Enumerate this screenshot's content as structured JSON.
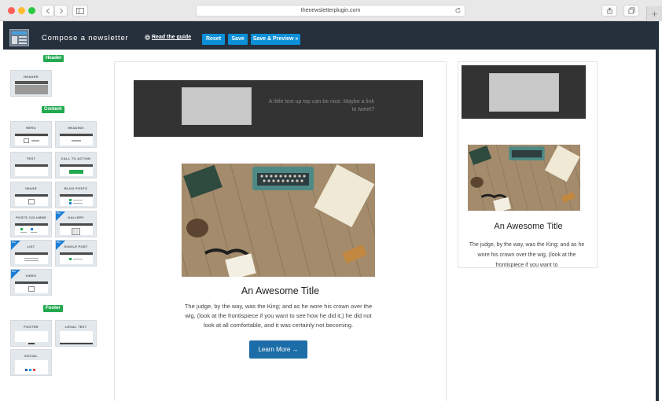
{
  "browser": {
    "url": "thenewsletterplugin.com",
    "new_tab_label": "+"
  },
  "topbar": {
    "title": "Compose a newsletter",
    "guide_label": "Read the guide",
    "reset_label": "Reset",
    "save_label": "Save",
    "save_preview_label": "Save & Preview »"
  },
  "sidebar": {
    "header_label": "Header",
    "content_label": "Content",
    "footer_label": "Footer",
    "pro_label": "Pro",
    "header_blocks": [
      {
        "label": "HEADER"
      }
    ],
    "content_blocks": [
      {
        "label": "HERO"
      },
      {
        "label": "HEADING"
      },
      {
        "label": "TEXT"
      },
      {
        "label": "CALL TO ACTION"
      },
      {
        "label": "IMAGE"
      },
      {
        "label": "BLOG POSTS"
      },
      {
        "label": "POSTS COLUMNS"
      },
      {
        "label": "GALLERY"
      },
      {
        "label": "LIST"
      },
      {
        "label": "SINGLE POST"
      },
      {
        "label": "VIDEO"
      }
    ],
    "footer_blocks": [
      {
        "label": "FOOTER"
      },
      {
        "label": "LEGAL TEXT"
      },
      {
        "label": "SOCIAL"
      }
    ]
  },
  "email": {
    "header_text": "A little text up top can be nice. Maybe a link to tweet?",
    "title": "An Awesome Title",
    "body": "The judge, by the way, was the King; and as he wore his crown over the wig, (look at the frontispiece if you want to see how he did it,) he did not look at all comfortable, and it was certainly not becoming.",
    "cta_label": "Learn More →"
  },
  "preview": {
    "title": "An Awesome Title",
    "body": "The judge, by the way, was the King; and as he wore his crown over the wig, (look at the frontispiece if you want to"
  },
  "colors": {
    "app_bar": "#26303d",
    "button_blue": "#0b8fd8",
    "badge_green": "#22a94f",
    "cta_blue": "#1d6ea8",
    "dark_header": "#333333"
  }
}
